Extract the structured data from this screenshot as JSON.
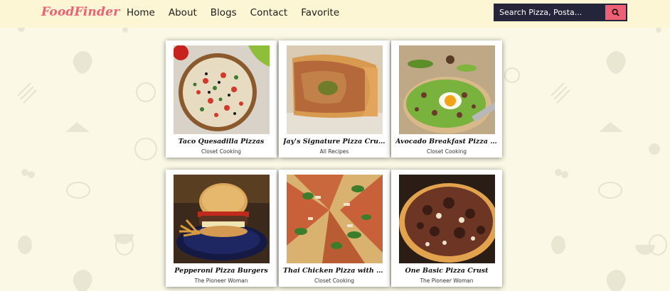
{
  "navbar": {
    "brand": "FoodFinder",
    "links": [
      "Home",
      "About",
      "Blogs",
      "Contact",
      "Favorite"
    ],
    "search": {
      "placeholder": "Search Pizza, Posta...",
      "button_icon": "search-icon"
    }
  },
  "recipes": [
    {
      "title": "Taco Quesadilla Pizzas",
      "source": "Closet Cooking",
      "image": "taco-pizza-photo"
    },
    {
      "title": "Jay's Signature Pizza Crust...",
      "source": "All Recipes",
      "image": "pizza-crust-slice-photo"
    },
    {
      "title": "Avocado Breakfast Pizza with...",
      "source": "Closet Cooking",
      "image": "avocado-egg-pizza-photo"
    },
    {
      "title": "Pepperoni Pizza Burgers",
      "source": "The Pioneer Woman",
      "image": "pizza-burger-photo"
    },
    {
      "title": "Thai Chicken Pizza with Sweet...",
      "source": "Closet Cooking",
      "image": "thai-chicken-pizza-photo"
    },
    {
      "title": "One Basic Pizza Crust",
      "source": "The Pioneer Woman",
      "image": "basic-pizza-crust-photo"
    }
  ],
  "colors": {
    "brand": "#ef5f76",
    "navbar_bg": "#fdf6d4",
    "page_bg": "#fbf9e6",
    "search_bg": "#24243b",
    "search_button": "#ef5f76"
  }
}
